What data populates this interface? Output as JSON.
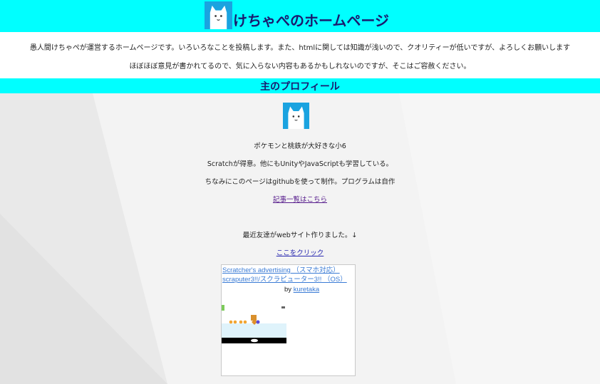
{
  "header": {
    "title": "けちゃぺのホームページ",
    "avatar_icon": "cat-avatar-icon",
    "bg_color": "#00ffff",
    "title_color": "#1a1a6e"
  },
  "intro": {
    "line1": "愚人間けちゃぺが運営するホームページです。いろいろなことを投稿します。また、htmlに関しては知識が浅いので、クオリティーが低いですが、よろしくお願いします",
    "line2": "ほぼほぼ意見が書かれてるので、気に入らない内容もあるかもしれないのですが、そこはご容赦ください。"
  },
  "profile": {
    "section_title": "主のプロフィール",
    "avatar_icon": "cat-avatar-icon",
    "line1": "ポケモンと桃鉄が大好きな小6",
    "line2": "Scratchが得意。他にもUnityやJavaScriptも学習している。",
    "line3": "ちなみにこのページはgithubを使って制作。プログラムは自作",
    "articles_link": "記事一覧はこちら"
  },
  "friend": {
    "text": "最近友達がwebサイト作りました。↓",
    "link": "ここをクリック"
  },
  "embed": {
    "title": "Scratcher's advertising （スマホ対応）scraputer3!!/スクラピューター3!! （OS）",
    "by_label": "by",
    "author": "kuretaka"
  }
}
